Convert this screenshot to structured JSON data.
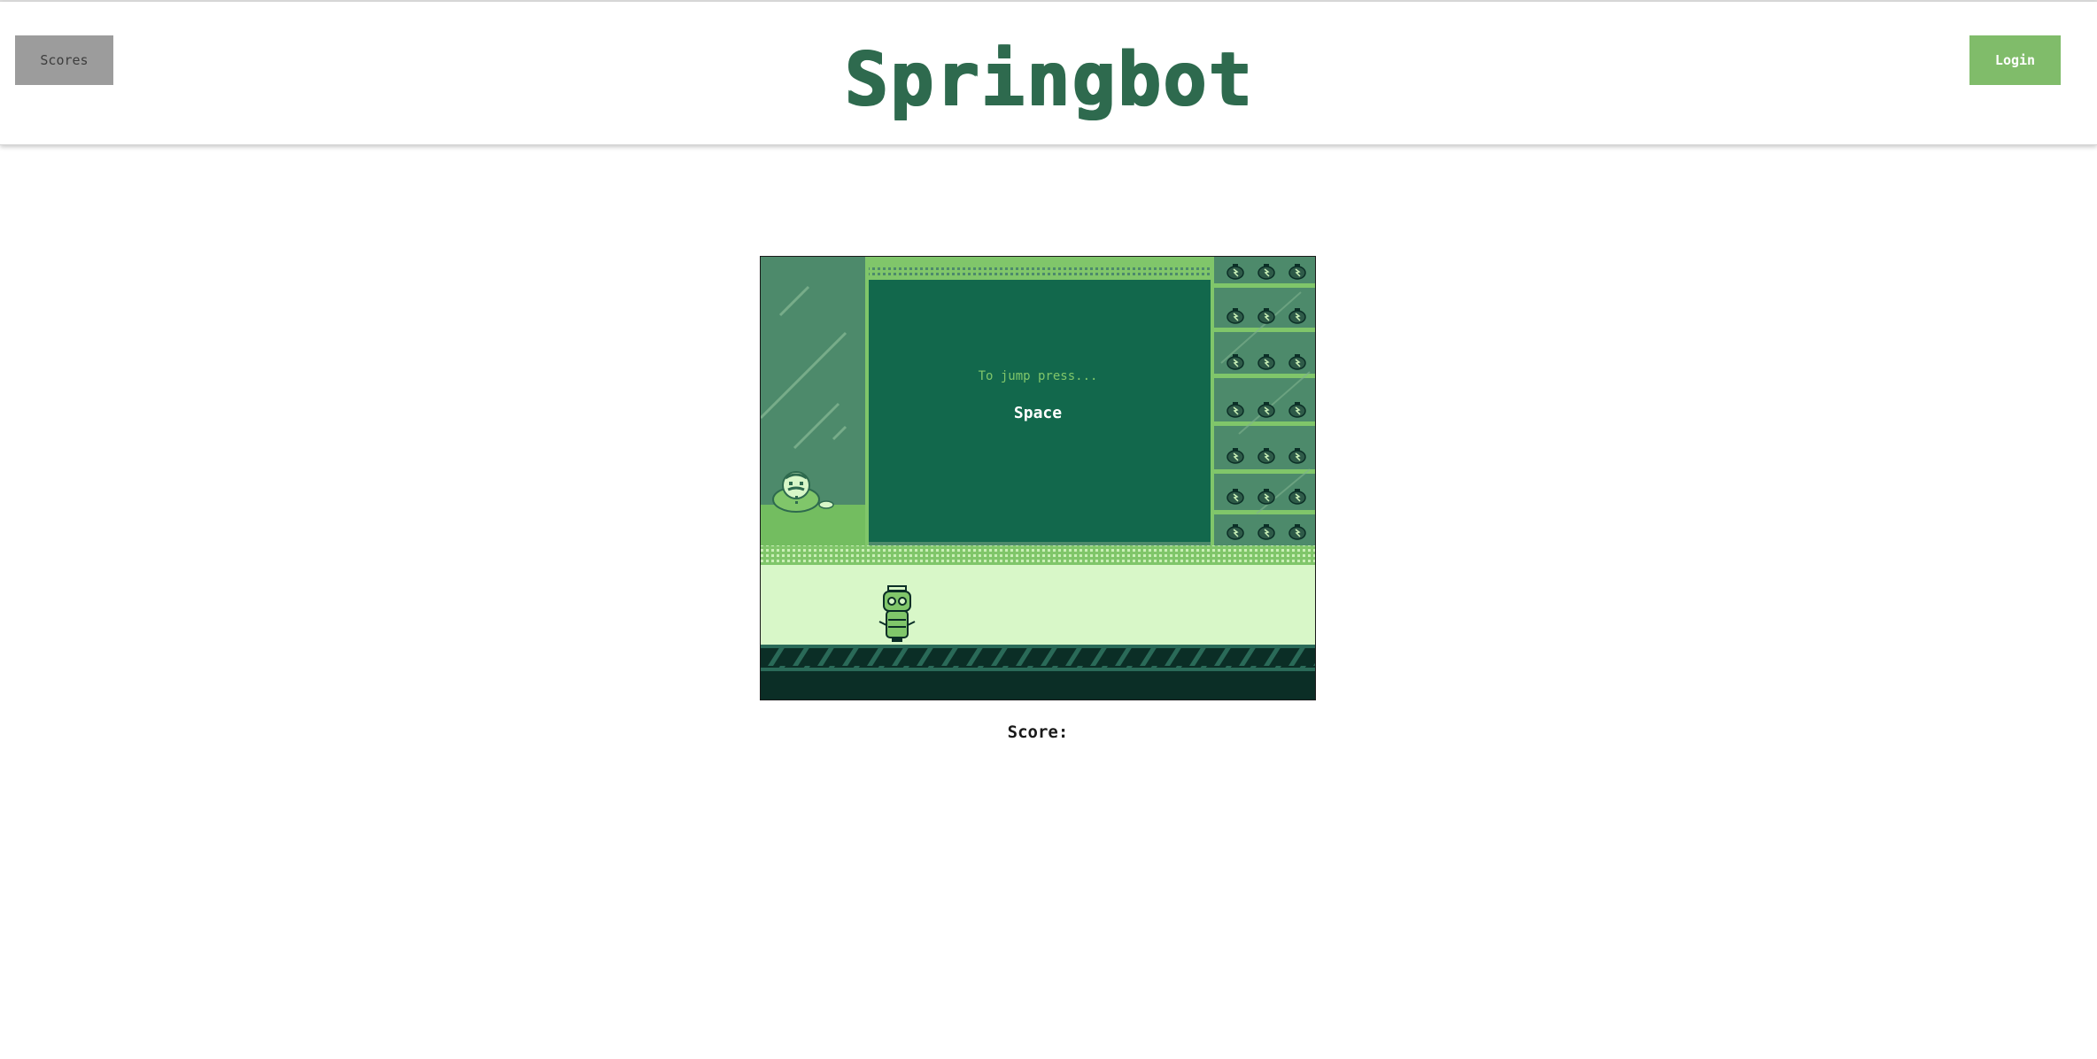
{
  "header": {
    "scores_label": "Scores",
    "title": "Springbot",
    "login_label": "Login"
  },
  "game": {
    "prompt_text": "To jump press...",
    "key_text": "Space",
    "score_label": "Score:",
    "characters": [
      "shopkeeper",
      "springbot-robot"
    ],
    "shelf_items": "battery-bag",
    "palette": {
      "dark": "#0b2e26",
      "screen": "#12684c",
      "wall": "#4d8a6b",
      "light": "#80c66a",
      "floor": "#d8f7c8"
    }
  }
}
